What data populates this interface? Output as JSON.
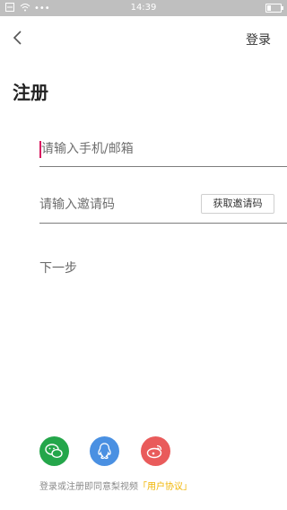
{
  "status_bar": {
    "time": "14:39",
    "dots": "•••"
  },
  "header": {
    "login_label": "登录"
  },
  "page": {
    "title": "注册"
  },
  "form": {
    "phone_placeholder": "请输入手机/邮箱",
    "invite_placeholder": "请输入邀请码",
    "get_code_label": "获取邀请码",
    "next_label": "下一步"
  },
  "social": {
    "icons": [
      "wechat-icon",
      "qq-icon",
      "weibo-icon"
    ]
  },
  "agreement": {
    "prefix": "登录或注册即同意梨视频",
    "link": "「用户协议」"
  },
  "colors": {
    "accent": "#f0b400",
    "wechat": "#24a64a",
    "qq": "#4a90e2",
    "weibo": "#e95b5b",
    "caret": "#d81b60"
  }
}
